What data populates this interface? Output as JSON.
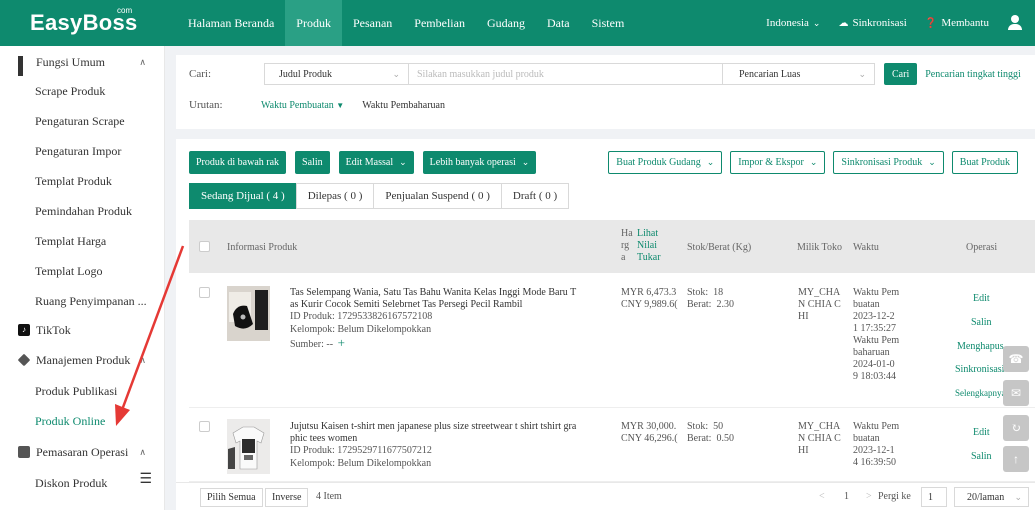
{
  "app": {
    "logo": "EasyBoss",
    "logo_com": "com"
  },
  "nav": {
    "items": [
      "Halaman Beranda",
      "Produk",
      "Pesanan",
      "Pembelian",
      "Gudang",
      "Data",
      "Sistem"
    ],
    "active": "Produk",
    "region": "Indonesia",
    "sync": "Sinkronisasi",
    "help": "Membantu"
  },
  "sidebar": {
    "group_general": "Fungsi Umum",
    "general_items": [
      "Scrape Produk",
      "Pengaturan Scrape",
      "Pengaturan Impor",
      "Templat Produk",
      "Pemindahan Produk",
      "Templat Harga",
      "Templat Logo",
      "Ruang Penyimpanan ..."
    ],
    "tiktok": "TikTok",
    "group_product": "Manajemen Produk",
    "product_items": [
      "Produk Publikasi",
      "Produk Online"
    ],
    "group_marketing": "Pemasaran Operasi",
    "marketing_items": [
      "Diskon Produk"
    ]
  },
  "search": {
    "label": "Cari:",
    "field": "Judul Produk",
    "placeholder": "Silakan masukkan judul produk",
    "mode": "Pencarian Luas",
    "button": "Cari",
    "advanced": "Pencarian tingkat tinggi",
    "sort_label": "Urutan:",
    "sort_created": "Waktu Pembuatan",
    "sort_updated": "Waktu Pembaharuan"
  },
  "toolbar": {
    "unlist": "Produk di bawah rak",
    "copy": "Salin",
    "batch_edit": "Edit Massal",
    "more": "Lebih banyak operasi",
    "warehouse": "Buat Produk Gudang",
    "import_export": "Impor & Ekspor",
    "sync_product": "Sinkronisasi Produk",
    "create_product": "Buat Produk"
  },
  "tabs": [
    {
      "label": "Sedang Dijual ( 4 )",
      "active": true
    },
    {
      "label": "Dilepas ( 0 )",
      "active": false
    },
    {
      "label": "Penjualan Suspend ( 0 )",
      "active": false
    },
    {
      "label": "Draft ( 0 )",
      "active": false
    }
  ],
  "table": {
    "col_info": "Informasi Produk",
    "col_price_a": "Ha",
    "col_price_b": "rg",
    "col_price_c": "a",
    "col_rate_a": "Lihat",
    "col_rate_b": "Nilai",
    "col_rate_c": "Tukar",
    "col_stock": "Stok/Berat (Kg)",
    "col_shop": "Milik Toko",
    "col_time": "Waktu",
    "col_ops": "Operasi",
    "rows": [
      {
        "title_1": "Tas Selempang Wania, Satu Tas Bahu Wanita Kelas Inggi Mode Baru T",
        "title_2": "as Kurir Cocok Semiti Selebrnet Tas Persegi Pecil Rambil",
        "id_label": "ID Produk:",
        "id": "1729533826167572108",
        "group_label": "Kelompok:",
        "group": "Belum Dikelompokkan",
        "source_label": "Sumber:",
        "source": "--",
        "price_myr": "MYR 6,473.3",
        "price_cny": "CNY 9,989.6(",
        "stock_label": "Stok:",
        "stock": "18",
        "weight_label": "Berat:",
        "weight": "2.30",
        "shop_1": "MY_CHA",
        "shop_2": "N CHIA C",
        "shop_3": "HI",
        "time": [
          "Waktu Pem",
          "buatan",
          "2023-12-2",
          "1 17:35:27",
          "Waktu Pem",
          "baharuan",
          "2024-01-0",
          "9 18:03:44"
        ],
        "ops": [
          "Edit",
          "Salin",
          "Menghapus",
          "Sinkronisasi",
          "Selengkapnya"
        ]
      },
      {
        "title_1": "Jujutsu Kaisen t-shirt men japanese plus size streetwear t shirt tshirt gra",
        "title_2": "phic tees women",
        "id_label": "ID Produk:",
        "id": "1729529711677507212",
        "group_label": "Kelompok:",
        "group": "Belum Dikelompokkan",
        "price_myr": "MYR 30,000.",
        "price_cny": "CNY 46,296.(",
        "stock_label": "Stok:",
        "stock": "50",
        "weight_label": "Berat:",
        "weight": "0.50",
        "shop_1": "MY_CHA",
        "shop_2": "N CHIA C",
        "shop_3": "HI",
        "time": [
          "Waktu Pem",
          "buatan",
          "2023-12-1",
          "4 16:39:50"
        ],
        "ops": [
          "Edit",
          "Salin"
        ]
      }
    ]
  },
  "footer": {
    "select_all": "Pilih Semua",
    "inverse": "Inverse",
    "count": "4 Item",
    "page": "1",
    "goto": "Pergi ke",
    "goto_value": "1",
    "per_page": "20/laman"
  },
  "colors": {
    "brand": "#0e8a6e",
    "annotation_arrow": "#e53935"
  }
}
